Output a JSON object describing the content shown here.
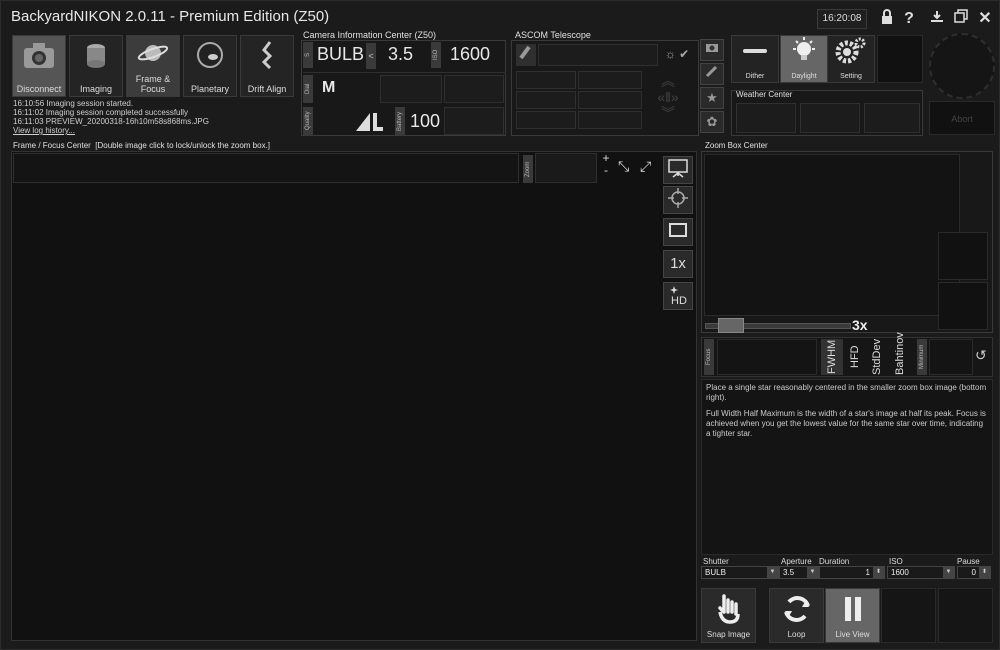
{
  "app": {
    "title": "BackyardNIKON 2.0.11 - Premium Edition (Z50)",
    "clock": "16:20:08"
  },
  "tools": [
    {
      "label": "Disconnect",
      "icon": "camera-icon"
    },
    {
      "label": "Imaging",
      "icon": "film-icon"
    },
    {
      "label": "Frame & Focus",
      "icon": "saturn-icon"
    },
    {
      "label": "Planetary",
      "icon": "planet-icon"
    },
    {
      "label": "Drift Align",
      "icon": "drift-icon"
    }
  ],
  "log": [
    "16:10:56  Imaging session started.",
    "16:11:02  Imaging session completed successfully",
    "16:11:03  PREVIEW_20200318-16h10m58s868ms.JPG",
    "View log history..."
  ],
  "camera": {
    "header": "Camera Information Center (Z50)",
    "shutter_label": "S",
    "shutter": "BULB",
    "aperture_arrow": "<",
    "aperture": "3.5",
    "iso_label": "ISO",
    "iso": "1600",
    "dial_label": "Dial",
    "mode": "M",
    "quality_label": "Quality",
    "quality_icon": "quality-icon",
    "battery_label": "Battery",
    "battery": "100"
  },
  "ascom": {
    "header": "ASCOM Telescope"
  },
  "modes": [
    {
      "label": "Dither"
    },
    {
      "label": "Daylight"
    },
    {
      "label": "Setting"
    }
  ],
  "weather": {
    "header": "Weather Center"
  },
  "abort": "Abort",
  "frame": {
    "header": "Frame / Focus Center",
    "hint": "[Double image click to lock/unlock the zoom box.]",
    "zoom_label": "Zoom",
    "zoom_plus": "+",
    "zoom_minus": "-",
    "zoom_level": "1x"
  },
  "zoombox": {
    "header": "Zoom Box Center",
    "zoom_value": "3x"
  },
  "focus": {
    "label": "Focus",
    "tabs": [
      "FWHM",
      "HFD",
      "StdDev",
      "Bahtinov"
    ],
    "minimum_label": "Minimum",
    "help1": "Place a single star reasonably centered in the smaller zoom box image (bottom right).",
    "help2": "Full Width Half Maximum is the width of a star's image at half its peak. Focus is achieved when you get the lowest value for the same star over time, indicating a tighter star."
  },
  "capture": {
    "shutter_label": "Shutter",
    "shutter": "BULB",
    "aperture_label": "Aperture",
    "aperture": "3.5",
    "duration_label": "Duration",
    "duration": "1",
    "iso_label": "ISO",
    "iso": "1600",
    "pause_label": "Pause",
    "pause": "0"
  },
  "actions": [
    {
      "label": "Snap Image"
    },
    {
      "label": "Loop"
    },
    {
      "label": "Live View"
    }
  ],
  "colors": {
    "bg": "#1b1b1b",
    "panel": "#181818",
    "border": "#3a3a3a",
    "active": "#555555",
    "text": "#dddddd"
  }
}
